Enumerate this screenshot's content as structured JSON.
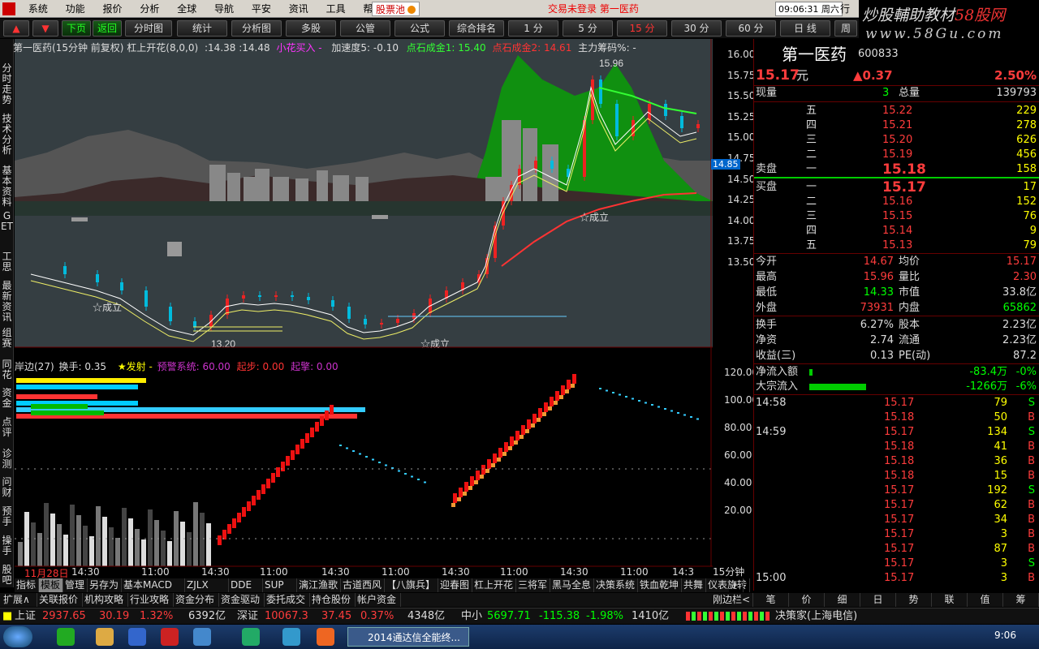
{
  "menu": {
    "items": [
      "系统",
      "功能",
      "报价",
      "分析",
      "全球",
      "导航",
      "平安",
      "资讯",
      "工具",
      "帮助"
    ],
    "stock_pool": "股票池",
    "notice": "交易未登录   第一医药",
    "clock": "09:06:31 周六",
    "extra": "行"
  },
  "brand": {
    "line1_a": "炒股輔助教材",
    "line1_b": "58股网",
    "line2": "www.58Gu.com"
  },
  "toolbar": {
    "nav": [
      "下页",
      "返回"
    ],
    "buttons": [
      "分时图",
      "统计",
      "分析图",
      "多股",
      "公管",
      "公式",
      "综合排名",
      "1 分",
      "5 分",
      "15 分",
      "30 分",
      "60 分",
      "日 线",
      "周"
    ]
  },
  "chart_header": {
    "title": "第一医药(15分钟 前复权) 杠上开花(8,0,0)",
    "price_vals": ":14.38 :14.48",
    "signal": "小花买入 -",
    "speed": "加速度5: -0.10",
    "gold1": "点石成金1: 15.40",
    "gold2": "点石成金2: 14.61",
    "chips": "主力筹码%: -"
  },
  "sidebar": {
    "items": [
      "分时走势",
      "技术分析",
      "基本资料",
      "GET",
      "工思",
      "最新资讯",
      "组赛",
      "同花",
      "资金",
      "点评",
      "诊测",
      "问财",
      "预手",
      "操手",
      "股吧"
    ]
  },
  "price_axis": [
    "16.00",
    "15.75",
    "15.50",
    "15.25",
    "15.00",
    "14.75",
    "14.50",
    "14.25",
    "14.00",
    "13.75",
    "13.50"
  ],
  "price_tag": "14.85",
  "annotations": {
    "high": "15.96",
    "low": "13.20",
    "est1": "☆成立",
    "est2": "☆成立",
    "est3": "☆成立"
  },
  "indicator_header": {
    "name": "岸边(27)",
    "turnover": "换手: 0.35",
    "launch": "★发射 -",
    "alarm": "预警系统: 60.00",
    "start": "起步: 0.00",
    "fly": "起擎: 0.00"
  },
  "ind_axis": [
    "120.00",
    "100.00",
    "80.00",
    "60.00",
    "40.00",
    "20.00"
  ],
  "time_axis": [
    "11月28日",
    "14:30",
    "11:00",
    "14:30",
    "11:00",
    "14:30",
    "11:00",
    "14:30",
    "11:00",
    "14:30",
    "11:00",
    "14:3"
  ],
  "time_tag": "15分钟",
  "tabs1": [
    "指标",
    "模板",
    "管理",
    "另存为",
    "基本MACD",
    "ZJLX",
    "DDE",
    "SUP",
    "漓江渔歌",
    "古道西风",
    "【八旗兵】",
    "迎春图",
    "杠上开花",
    "三将军",
    "黑马全息",
    "决策系统",
    "铁血乾坤",
    "共舞",
    "仪表旋转"
  ],
  "tabs1_ctrl": [
    "+",
    "0"
  ],
  "tabs2": [
    "扩展∧",
    "关联报价",
    "机构攻略",
    "行业攻略",
    "资金分布",
    "资金驱动",
    "委托成交",
    "持仓股份",
    "帐户资金"
  ],
  "tabs2_right": "刚边栏<",
  "quote": {
    "name": "第一医药",
    "code": "600833",
    "price": "15.17",
    "price_unit": "元",
    "change": "▲0.37",
    "pct": "2.50%",
    "cur_vol_label": "现量",
    "cur_vol": "3",
    "total_label": "总量",
    "total": "139793",
    "sell": [
      {
        "l": "五",
        "p": "15.22",
        "v": "229"
      },
      {
        "l": "四",
        "p": "15.21",
        "v": "278"
      },
      {
        "l": "三",
        "p": "15.20",
        "v": "626"
      },
      {
        "l": "二",
        "p": "15.19",
        "v": "456"
      },
      {
        "l": "一",
        "p": "15.18",
        "v": "158"
      }
    ],
    "sell_label": "卖盘",
    "buy_label": "买盘",
    "buy": [
      {
        "l": "一",
        "p": "15.17",
        "v": "17"
      },
      {
        "l": "二",
        "p": "15.16",
        "v": "152"
      },
      {
        "l": "三",
        "p": "15.15",
        "v": "76"
      },
      {
        "l": "四",
        "p": "15.14",
        "v": "9"
      },
      {
        "l": "五",
        "p": "15.13",
        "v": "79"
      }
    ],
    "stats": [
      {
        "a": "今开",
        "av": "14.67",
        "b": "均价",
        "bv": "15.17"
      },
      {
        "a": "最高",
        "av": "15.96",
        "b": "量比",
        "bv": "2.30"
      },
      {
        "a": "最低",
        "av": "14.33",
        "b": "市值",
        "bv": "33.8亿"
      },
      {
        "a": "外盘",
        "av": "73931",
        "b": "内盘",
        "bv": "65862"
      }
    ],
    "stats2": [
      {
        "a": "换手",
        "av": "6.27%",
        "b": "股本",
        "bv": "2.23亿"
      },
      {
        "a": "净资",
        "av": "2.74",
        "b": "流通",
        "bv": "2.23亿"
      },
      {
        "a": "收益(三)",
        "av": "0.13",
        "b": "PE(动)",
        "bv": "87.2"
      }
    ],
    "flow": [
      {
        "l": "净流入额",
        "v": "-83.4万",
        "p": "-0%"
      },
      {
        "l": "大宗流入",
        "v": "-1266万",
        "p": "-6%"
      }
    ],
    "ticks": [
      {
        "t": "14:58",
        "p": "15.17",
        "v": "79",
        "d": "S"
      },
      {
        "t": "",
        "p": "15.18",
        "v": "50",
        "d": "B"
      },
      {
        "t": "14:59",
        "p": "15.17",
        "v": "134",
        "d": "S"
      },
      {
        "t": "",
        "p": "15.18",
        "v": "41",
        "d": "B"
      },
      {
        "t": "",
        "p": "15.18",
        "v": "36",
        "d": "B"
      },
      {
        "t": "",
        "p": "15.18",
        "v": "15",
        "d": "B"
      },
      {
        "t": "",
        "p": "15.17",
        "v": "192",
        "d": "S"
      },
      {
        "t": "",
        "p": "15.17",
        "v": "62",
        "d": "B"
      },
      {
        "t": "",
        "p": "15.17",
        "v": "34",
        "d": "B"
      },
      {
        "t": "",
        "p": "15.17",
        "v": "3",
        "d": "B"
      },
      {
        "t": "",
        "p": "15.17",
        "v": "87",
        "d": "B"
      },
      {
        "t": "",
        "p": "15.17",
        "v": "3",
        "d": "S"
      },
      {
        "t": "15:00",
        "p": "15.17",
        "v": "3",
        "d": "B"
      }
    ],
    "tabs": [
      "笔",
      "价",
      "细",
      "日",
      "势",
      "联",
      "值",
      "筹"
    ]
  },
  "status": {
    "sh_label": "上证",
    "sh": "2937.65",
    "sh_chg": "30.19",
    "sh_pct": "1.32%",
    "sh_amt": "6392亿",
    "sz_label": "深证",
    "sz": "10067.3",
    "sz_chg": "37.45",
    "sz_pct": "0.37%",
    "sz_amt": "4348亿",
    "zx_label": "中小",
    "zx": "5697.71",
    "zx_chg": "-115.38",
    "zx_pct": "-1.98%",
    "zx_amt": "1410亿",
    "broker": "决策家(上海电信)"
  },
  "taskbar": {
    "window": "2014通达信全能终...",
    "time": "9:06"
  }
}
